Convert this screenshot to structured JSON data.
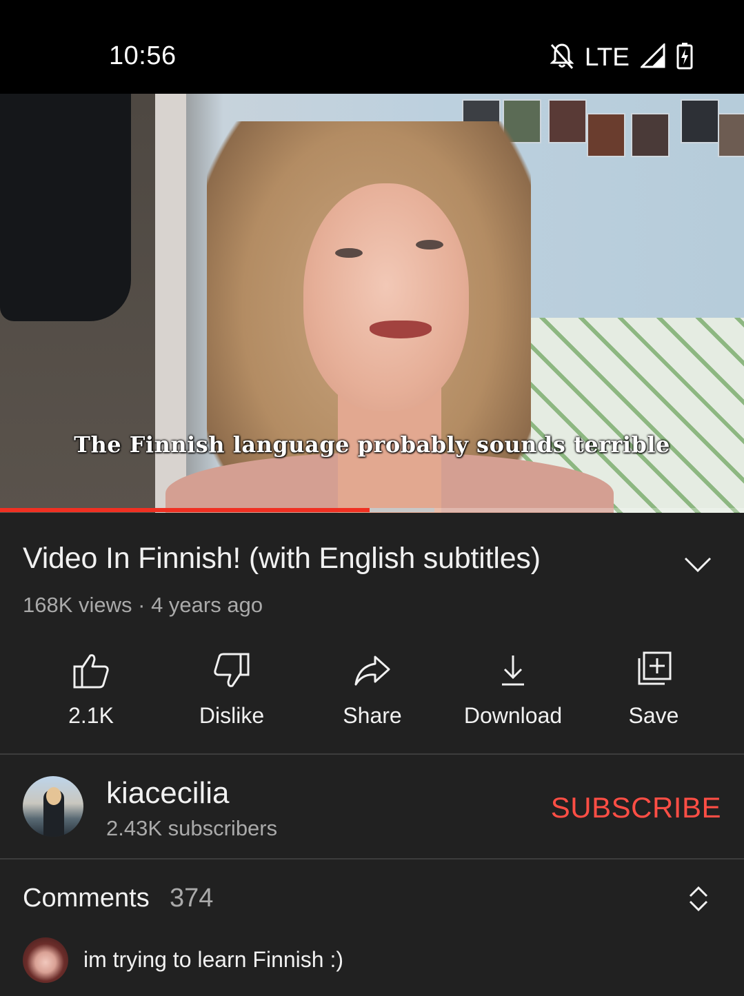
{
  "status_bar": {
    "time": "10:56",
    "network": "LTE",
    "icons": [
      "notifications-off-icon",
      "signal-icon",
      "battery-charging-icon"
    ]
  },
  "video": {
    "subtitle": "The Finnish language probably sounds terrible",
    "progress_played": 0.497,
    "progress_buffered": 0.584,
    "progress_color": "#f03022"
  },
  "details": {
    "title": "Video In Finnish! (with English subtitles)",
    "meta": "168K views · 4 years ago"
  },
  "actions": [
    {
      "label": "2.1K",
      "icon": "thumb-up-icon"
    },
    {
      "label": "Dislike",
      "icon": "thumb-down-icon"
    },
    {
      "label": "Share",
      "icon": "share-icon"
    },
    {
      "label": "Download",
      "icon": "download-icon"
    },
    {
      "label": "Save",
      "icon": "add-to-playlist-icon"
    }
  ],
  "channel": {
    "name": "kiacecilia",
    "subscribers": "2.43K subscribers",
    "subscribe_label": "SUBSCRIBE",
    "subscribe_color": "#ff4e45"
  },
  "comments": {
    "title": "Comments",
    "count": "374",
    "top_comment": "im trying to learn Finnish :)"
  }
}
